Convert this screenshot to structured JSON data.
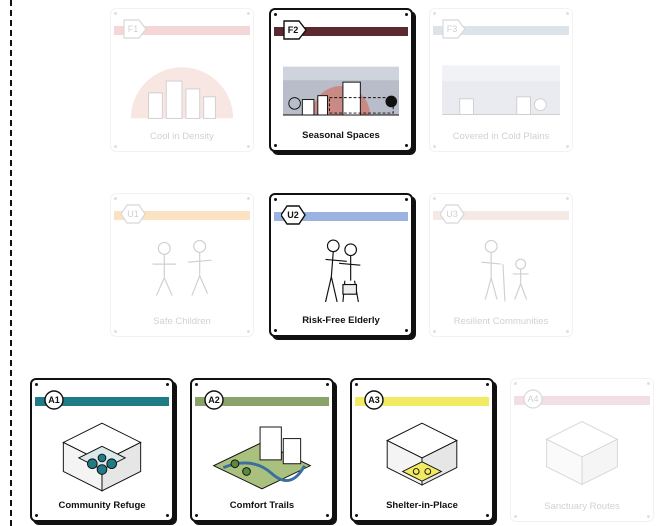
{
  "rows": {
    "seasons": [
      {
        "code": "F1",
        "label": "Cool in Density",
        "color": "#e7a6a6",
        "active": false,
        "icon": "hexagon-tag-icon"
      },
      {
        "code": "F2",
        "label": "Seasonal Spaces",
        "color": "#5a2a30",
        "active": true,
        "icon": "hexagon-tag-icon"
      },
      {
        "code": "F3",
        "label": "Covered in Cold Plains",
        "color": "#b4c4d0",
        "active": false,
        "icon": "hexagon-tag-icon"
      }
    ],
    "users": [
      {
        "code": "U1",
        "label": "Safe Children",
        "color": "#f5c07a",
        "active": false,
        "icon": "hexagon-badge-icon"
      },
      {
        "code": "U2",
        "label": "Risk-Free Elderly",
        "color": "#9bb3e0",
        "active": true,
        "icon": "hexagon-badge-icon"
      },
      {
        "code": "U3",
        "label": "Resilient Communities",
        "color": "#e7cfc6",
        "active": false,
        "icon": "hexagon-badge-icon"
      }
    ],
    "actions": [
      {
        "code": "A1",
        "label": "Community Refuge",
        "color": "#1f7b86",
        "active": true,
        "icon": "circle-badge-icon"
      },
      {
        "code": "A2",
        "label": "Comfort Trails",
        "color": "#8aa36b",
        "active": true,
        "icon": "circle-badge-icon"
      },
      {
        "code": "A3",
        "label": "Shelter-in-Place",
        "color": "#f2ea62",
        "active": true,
        "icon": "circle-badge-icon"
      },
      {
        "code": "A4",
        "label": "Sanctuary Routes",
        "color": "#e3b9c3",
        "active": false,
        "icon": "circle-badge-icon"
      }
    ]
  }
}
